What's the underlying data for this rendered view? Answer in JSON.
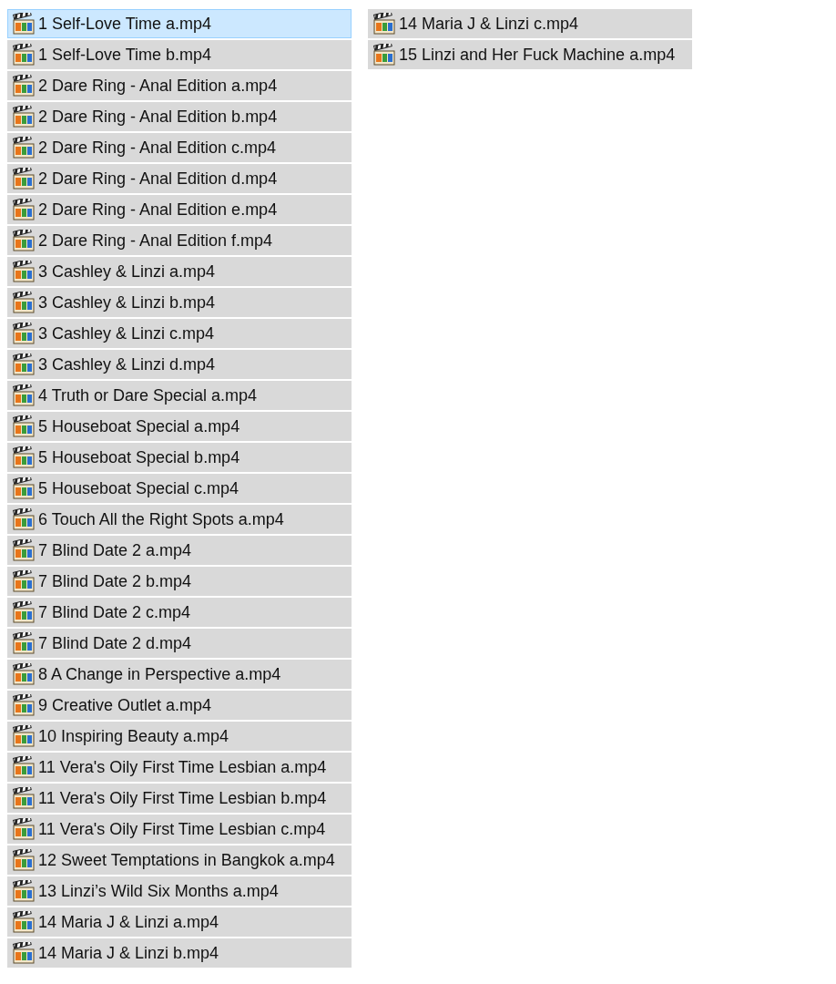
{
  "files": [
    {
      "name": "1 Self-Love Time a.mp4",
      "selected": true
    },
    {
      "name": "1 Self-Love Time b.mp4",
      "selected": false
    },
    {
      "name": "2 Dare Ring - Anal Edition a.mp4",
      "selected": false
    },
    {
      "name": "2 Dare Ring - Anal Edition b.mp4",
      "selected": false
    },
    {
      "name": "2 Dare Ring - Anal Edition c.mp4",
      "selected": false
    },
    {
      "name": "2 Dare Ring - Anal Edition d.mp4",
      "selected": false
    },
    {
      "name": "2 Dare Ring - Anal Edition e.mp4",
      "selected": false
    },
    {
      "name": "2 Dare Ring - Anal Edition f.mp4",
      "selected": false
    },
    {
      "name": "3 Cashley & Linzi a.mp4",
      "selected": false
    },
    {
      "name": "3 Cashley & Linzi b.mp4",
      "selected": false
    },
    {
      "name": "3 Cashley & Linzi c.mp4",
      "selected": false
    },
    {
      "name": "3 Cashley & Linzi d.mp4",
      "selected": false
    },
    {
      "name": "4 Truth or Dare Special a.mp4",
      "selected": false
    },
    {
      "name": "5 Houseboat Special a.mp4",
      "selected": false
    },
    {
      "name": "5 Houseboat Special b.mp4",
      "selected": false
    },
    {
      "name": "5 Houseboat Special c.mp4",
      "selected": false
    },
    {
      "name": "6 Touch All the Right Spots a.mp4",
      "selected": false
    },
    {
      "name": "7 Blind Date 2 a.mp4",
      "selected": false
    },
    {
      "name": "7 Blind Date 2 b.mp4",
      "selected": false
    },
    {
      "name": "7 Blind Date 2 c.mp4",
      "selected": false
    },
    {
      "name": "7 Blind Date 2 d.mp4",
      "selected": false
    },
    {
      "name": "8 A Change in Perspective a.mp4",
      "selected": false
    },
    {
      "name": "9 Creative Outlet a.mp4",
      "selected": false
    },
    {
      "name": "10 Inspiring Beauty a.mp4",
      "selected": false
    },
    {
      "name": "11 Vera's Oily First Time Lesbian a.mp4",
      "selected": false
    },
    {
      "name": "11 Vera's Oily First Time Lesbian b.mp4",
      "selected": false
    },
    {
      "name": "11 Vera's Oily First Time Lesbian c.mp4",
      "selected": false
    },
    {
      "name": "12 Sweet Temptations in Bangkok a.mp4",
      "selected": false
    },
    {
      "name": "13 Linzi’s Wild Six Months a.mp4",
      "selected": false
    },
    {
      "name": "14 Maria J & Linzi a.mp4",
      "selected": false
    },
    {
      "name": "14 Maria J & Linzi b.mp4",
      "selected": false
    },
    {
      "name": "14 Maria J & Linzi c.mp4",
      "selected": false
    },
    {
      "name": "15 Linzi and Her Fuck Machine a.mp4",
      "selected": false
    }
  ]
}
